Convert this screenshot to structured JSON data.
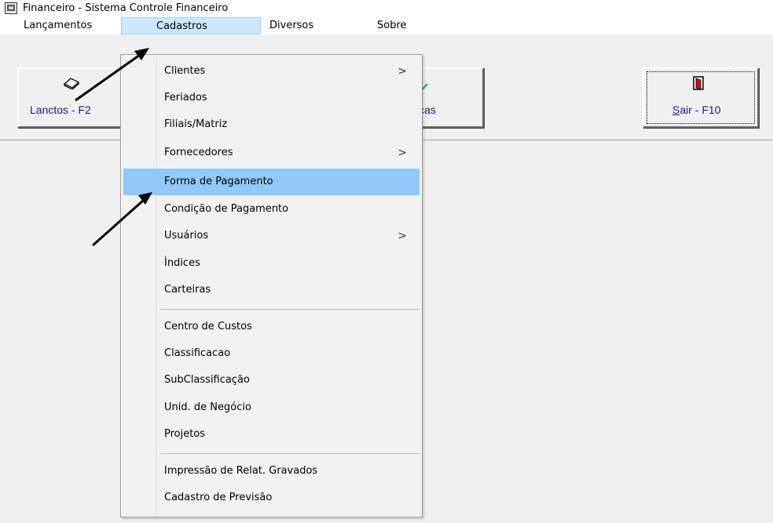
{
  "window": {
    "title": "Financeiro - Sistema Controle Financeiro",
    "icon": "app-icon"
  },
  "menubar": {
    "items": [
      "Lançamentos",
      "Cadastros",
      "Diversos",
      "Sobre"
    ],
    "active": "Cadastros"
  },
  "toolbar": {
    "buttons": [
      {
        "label": "Lanctos - F2",
        "icon": "book-icon"
      },
      {
        "label": "icas",
        "icon": "check-icon"
      },
      {
        "label": "Sair - F10",
        "icon": "exit-door-icon"
      }
    ]
  },
  "dropdown": {
    "items": [
      {
        "label": "Clientes",
        "submenu": true
      },
      {
        "label": "Feriados",
        "submenu": false
      },
      {
        "label": "Filiais/Matriz",
        "submenu": false
      },
      {
        "label": "Fornecedores",
        "submenu": true
      },
      {
        "label": "Forma de Pagamento",
        "submenu": false,
        "highlighted": true
      },
      {
        "label": "Condição de Pagamento",
        "submenu": false
      },
      {
        "label": "Usuários",
        "submenu": true
      },
      {
        "label": "Ìndices",
        "submenu": false
      },
      {
        "label": "Carteiras",
        "submenu": false
      },
      {
        "label": "Centro de Custos",
        "submenu": false
      },
      {
        "label": "Classificacao",
        "submenu": false
      },
      {
        "label": "SubClassificação",
        "submenu": false
      },
      {
        "label": "Unid. de Negócio",
        "submenu": false
      },
      {
        "label": "Projetos",
        "submenu": false
      },
      {
        "label": "Impressão de Relat. Gravados",
        "submenu": false
      },
      {
        "label": "Cadastro de Previsão",
        "submenu": false
      }
    ],
    "submenu_glyph": ">"
  },
  "colors": {
    "highlight": "#91c9f7",
    "menu_active": "#cce8ff",
    "button_text": "#1a1a8c"
  }
}
